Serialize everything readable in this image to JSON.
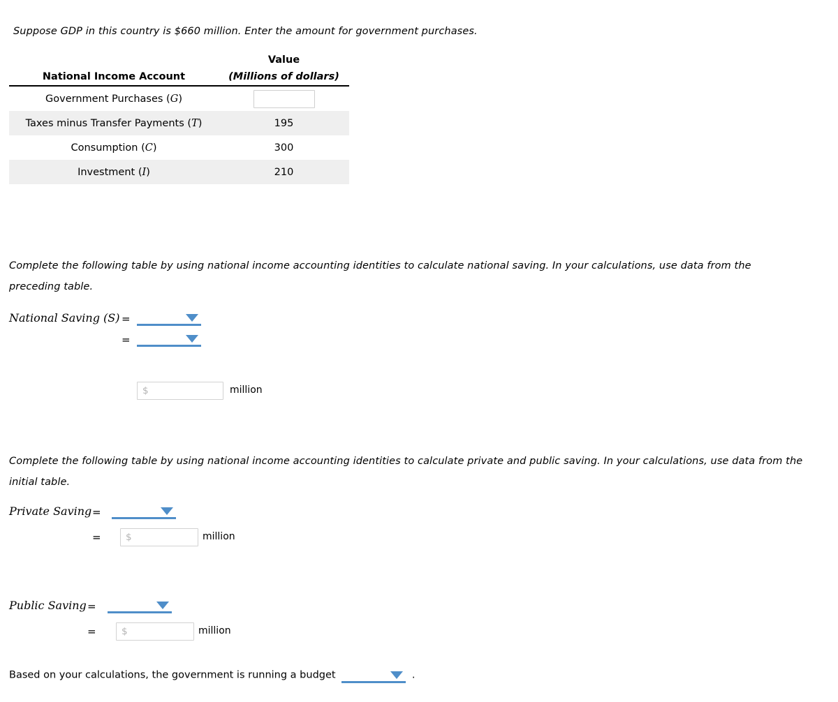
{
  "intro": {
    "text": "Suppose GDP in this country is $660 million. Enter the amount for government purchases."
  },
  "table": {
    "headers": {
      "account": "National Income Account",
      "value_line1": "Value",
      "value_line2": "(Millions of dollars)"
    },
    "rows": [
      {
        "label": "Government Purchases (",
        "symbol": "G",
        "label_end": ")",
        "value": "",
        "input": true,
        "shaded": false
      },
      {
        "label": "Taxes minus Transfer Payments (",
        "symbol": "T",
        "label_end": ")",
        "value": "195",
        "input": false,
        "shaded": true
      },
      {
        "label": "Consumption (",
        "symbol": "C",
        "label_end": ")",
        "value": "300",
        "input": false,
        "shaded": false
      },
      {
        "label": "Investment (",
        "symbol": "I",
        "label_end": ")",
        "value": "210",
        "input": false,
        "shaded": true
      }
    ]
  },
  "instruction_national": {
    "text": "Complete the following table by using national income accounting identities to calculate national saving. In your calculations, use data from the preceding table."
  },
  "national_saving": {
    "label": "National Saving (S)",
    "eq1": "=",
    "eq2": "=",
    "dropdown1_value": "",
    "dropdown2_value": "",
    "amount_placeholder": "$",
    "amount_value": "",
    "unit": "million"
  },
  "instruction_private_public": {
    "text": "Complete the following table by using national income accounting identities to calculate private and public saving. In your calculations, use data from the initial table."
  },
  "private_saving": {
    "label": "Private Saving",
    "eq1": "=",
    "eq2": "=",
    "dropdown_value": "",
    "amount_placeholder": "$",
    "amount_value": "",
    "unit": "million"
  },
  "public_saving": {
    "label": "Public Saving",
    "eq1": "=",
    "eq2": "=",
    "dropdown_value": "",
    "amount_placeholder": "$",
    "amount_value": "",
    "unit": "million"
  },
  "conclusion": {
    "text_before": "Based on your calculations, the government is running a budget",
    "dropdown_value": "",
    "text_after": "."
  },
  "colors": {
    "dropdown_blue": "#4f8ec9",
    "row_shade": "#efefef",
    "rule": "#000000",
    "input_border": "#cfcfcf",
    "placeholder": "#b3b3b3"
  }
}
